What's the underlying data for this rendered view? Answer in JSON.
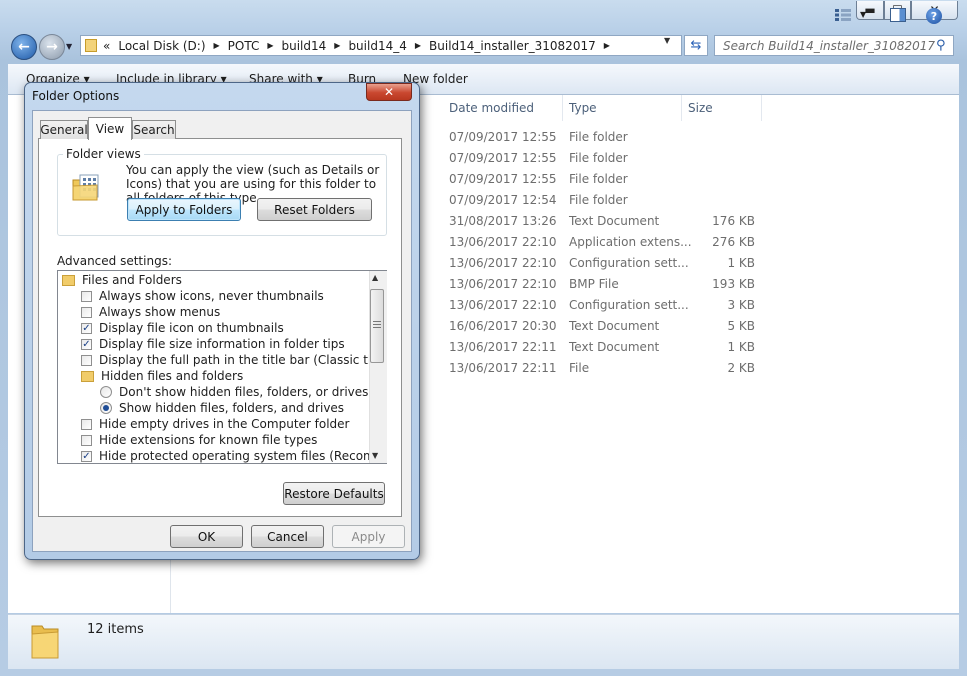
{
  "explorer": {
    "address": {
      "overflow": "«",
      "segments": [
        "Local Disk (D:)",
        "POTC",
        "build14",
        "build14_4",
        "Build14_installer_31082017"
      ]
    },
    "search_placeholder": "Search Build14_installer_31082017",
    "toolbar": {
      "organize": "Organize ▾",
      "include_in_library": "Include in library ▾",
      "share_with": "Share with ▾",
      "burn": "Burn",
      "new_folder": "New folder"
    },
    "columns": {
      "date": "Date modified",
      "type": "Type",
      "size": "Size"
    },
    "rows": [
      {
        "date": "07/09/2017 12:55",
        "type": "File folder",
        "size": ""
      },
      {
        "date": "07/09/2017 12:55",
        "type": "File folder",
        "size": ""
      },
      {
        "date": "07/09/2017 12:55",
        "type": "File folder",
        "size": ""
      },
      {
        "date": "07/09/2017 12:54",
        "type": "File folder",
        "size": ""
      },
      {
        "date": "31/08/2017 13:26",
        "type": "Text Document",
        "size": "176 KB"
      },
      {
        "date": "13/06/2017 22:10",
        "type": "Application extens...",
        "size": "276 KB"
      },
      {
        "date": "13/06/2017 22:10",
        "type": "Configuration sett...",
        "size": "1 KB"
      },
      {
        "date": "13/06/2017 22:10",
        "type": "BMP File",
        "size": "193 KB"
      },
      {
        "date": "13/06/2017 22:10",
        "type": "Configuration sett...",
        "size": "3 KB"
      },
      {
        "date": "16/06/2017 20:30",
        "type": "Text Document",
        "size": "5 KB"
      },
      {
        "date": "13/06/2017 22:11",
        "type": "Text Document",
        "size": "1 KB"
      },
      {
        "date": "13/06/2017 22:11",
        "type": "File",
        "size": "2 KB"
      }
    ],
    "status": {
      "item_count": "12 items"
    },
    "window_buttons": {
      "minimize": "▬",
      "maximize": "☐",
      "close": "✕"
    }
  },
  "dialog": {
    "title": "Folder Options",
    "close": "✕",
    "tabs": {
      "general": "General",
      "view": "View",
      "search": "Search"
    },
    "folder_views": {
      "label": "Folder views",
      "description": "You can apply the view (such as Details or Icons) that you are using for this folder to all folders of this type.",
      "apply_button": "Apply to Folders",
      "reset_button": "Reset Folders"
    },
    "advanced": {
      "label": "Advanced settings:",
      "items": [
        {
          "kind": "folder",
          "label": "Files and Folders",
          "indent": 0,
          "checked": false
        },
        {
          "kind": "check",
          "label": "Always show icons, never thumbnails",
          "indent": 1,
          "checked": false
        },
        {
          "kind": "check",
          "label": "Always show menus",
          "indent": 1,
          "checked": false
        },
        {
          "kind": "check",
          "label": "Display file icon on thumbnails",
          "indent": 1,
          "checked": true
        },
        {
          "kind": "check",
          "label": "Display file size information in folder tips",
          "indent": 1,
          "checked": true
        },
        {
          "kind": "check",
          "label": "Display the full path in the title bar (Classic theme only)",
          "indent": 1,
          "checked": false
        },
        {
          "kind": "folder",
          "label": "Hidden files and folders",
          "indent": 1,
          "checked": false
        },
        {
          "kind": "radio",
          "label": "Don't show hidden files, folders, or drives",
          "indent": 2,
          "checked": false
        },
        {
          "kind": "radio",
          "label": "Show hidden files, folders, and drives",
          "indent": 2,
          "checked": true
        },
        {
          "kind": "check",
          "label": "Hide empty drives in the Computer folder",
          "indent": 1,
          "checked": false
        },
        {
          "kind": "check",
          "label": "Hide extensions for known file types",
          "indent": 1,
          "checked": false
        },
        {
          "kind": "check",
          "label": "Hide protected operating system files (Recommended)",
          "indent": 1,
          "checked": true
        }
      ]
    },
    "restore_button": "Restore Defaults",
    "ok_button": "OK",
    "cancel_button": "Cancel",
    "apply_button": "Apply"
  }
}
